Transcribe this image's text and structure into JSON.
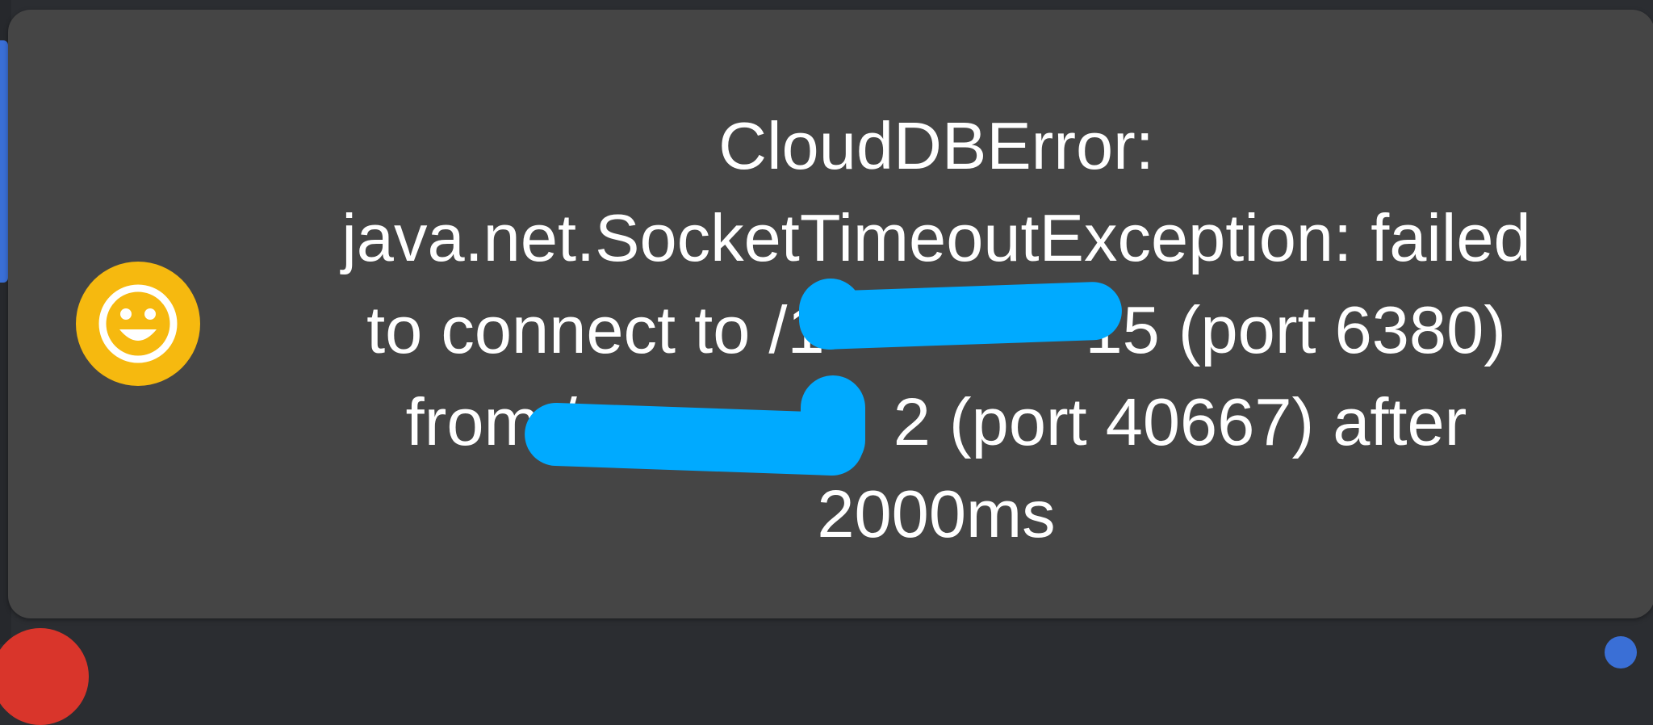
{
  "toast": {
    "icon": "smiley-face-icon",
    "message_lines": [
      "CloudDBError:",
      "java.net.SocketTimeoutException: failed",
      "to connect to /1              15 (port 6380)",
      "from /                 2 (port 40667) after",
      "2000ms"
    ]
  },
  "colors": {
    "toast_background": "#454545",
    "icon_background": "#f6b90f",
    "redaction": "#00aaff",
    "text": "#ffffff"
  }
}
